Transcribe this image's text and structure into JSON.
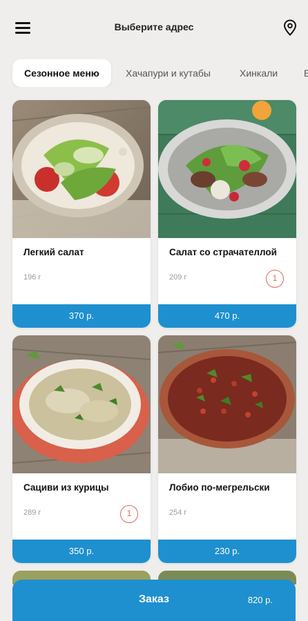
{
  "header": {
    "title": "Выберите адрес",
    "menu_icon": "hamburger-menu-icon",
    "location_icon": "map-pin-icon"
  },
  "tabs": [
    {
      "label": "Сезонное меню",
      "active": true
    },
    {
      "label": "Хачапури и кутабы",
      "active": false
    },
    {
      "label": "Хинкали",
      "active": false
    },
    {
      "label": "Б",
      "active": false
    }
  ],
  "products": [
    {
      "title": "Легкий салат",
      "weight": "196 г",
      "price": "370 р.",
      "count": ""
    },
    {
      "title": "Салат со страчателлой",
      "weight": "209 г",
      "price": "470 р.",
      "count": "1"
    },
    {
      "title": "Сациви из курицы",
      "weight": "289 г",
      "price": "350 р.",
      "count": "1"
    },
    {
      "title": "Лобио по-мегрельски",
      "weight": "254 г",
      "price": "230 р.",
      "count": ""
    }
  ],
  "order": {
    "label": "Заказ",
    "total": "820 р."
  },
  "colors": {
    "accent": "#1e90cf",
    "badge": "#e06a5b",
    "background": "#efeeec"
  }
}
